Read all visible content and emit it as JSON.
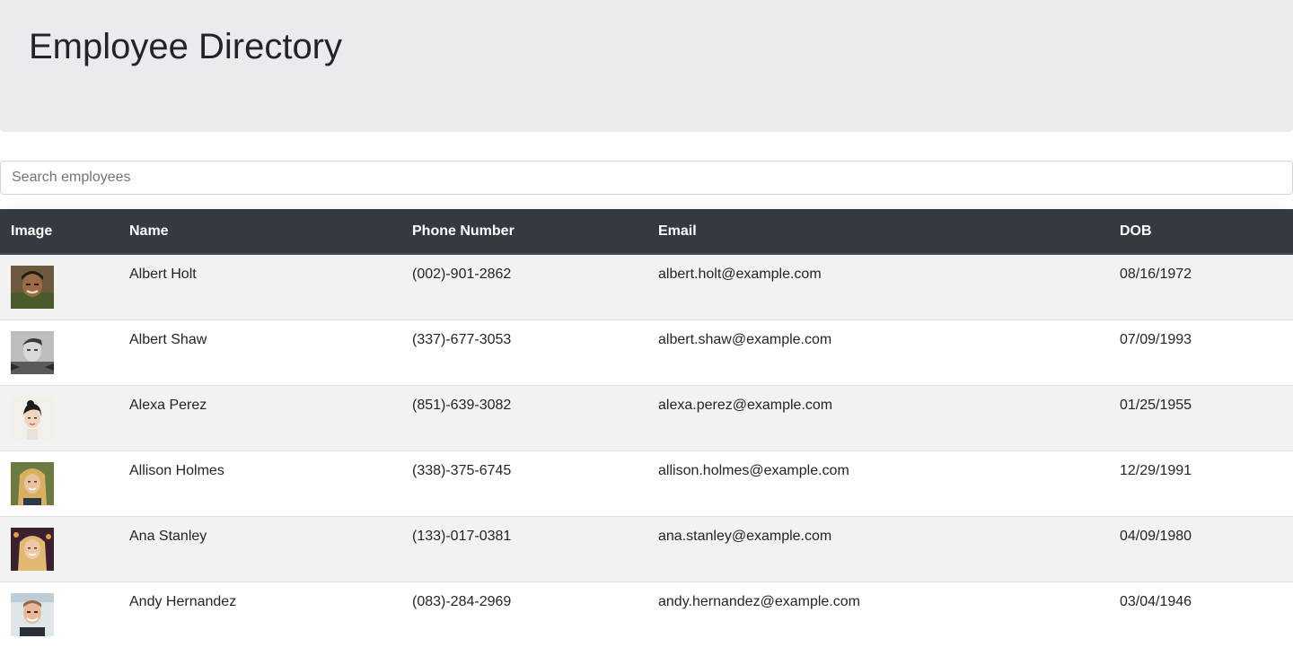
{
  "header": {
    "title": "Employee Directory"
  },
  "search": {
    "placeholder": "Search employees",
    "value": ""
  },
  "table": {
    "columns": [
      "Image",
      "Name",
      "Phone Number",
      "Email",
      "DOB"
    ],
    "rows": [
      {
        "name": "Albert Holt",
        "phone": "(002)-901-2862",
        "email": "albert.holt@example.com",
        "dob": "08/16/1972"
      },
      {
        "name": "Albert Shaw",
        "phone": "(337)-677-3053",
        "email": "albert.shaw@example.com",
        "dob": "07/09/1993"
      },
      {
        "name": "Alexa Perez",
        "phone": "(851)-639-3082",
        "email": "alexa.perez@example.com",
        "dob": "01/25/1955"
      },
      {
        "name": "Allison Holmes",
        "phone": "(338)-375-6745",
        "email": "allison.holmes@example.com",
        "dob": "12/29/1991"
      },
      {
        "name": "Ana Stanley",
        "phone": "(133)-017-0381",
        "email": "ana.stanley@example.com",
        "dob": "04/09/1980"
      },
      {
        "name": "Andy Hernandez",
        "phone": "(083)-284-2969",
        "email": "andy.hernandez@example.com",
        "dob": "03/04/1946"
      }
    ]
  },
  "colors": {
    "jumbotron_bg": "#e9ecef",
    "table_header_bg": "#343a40",
    "stripe_bg": "#f2f2f2"
  }
}
